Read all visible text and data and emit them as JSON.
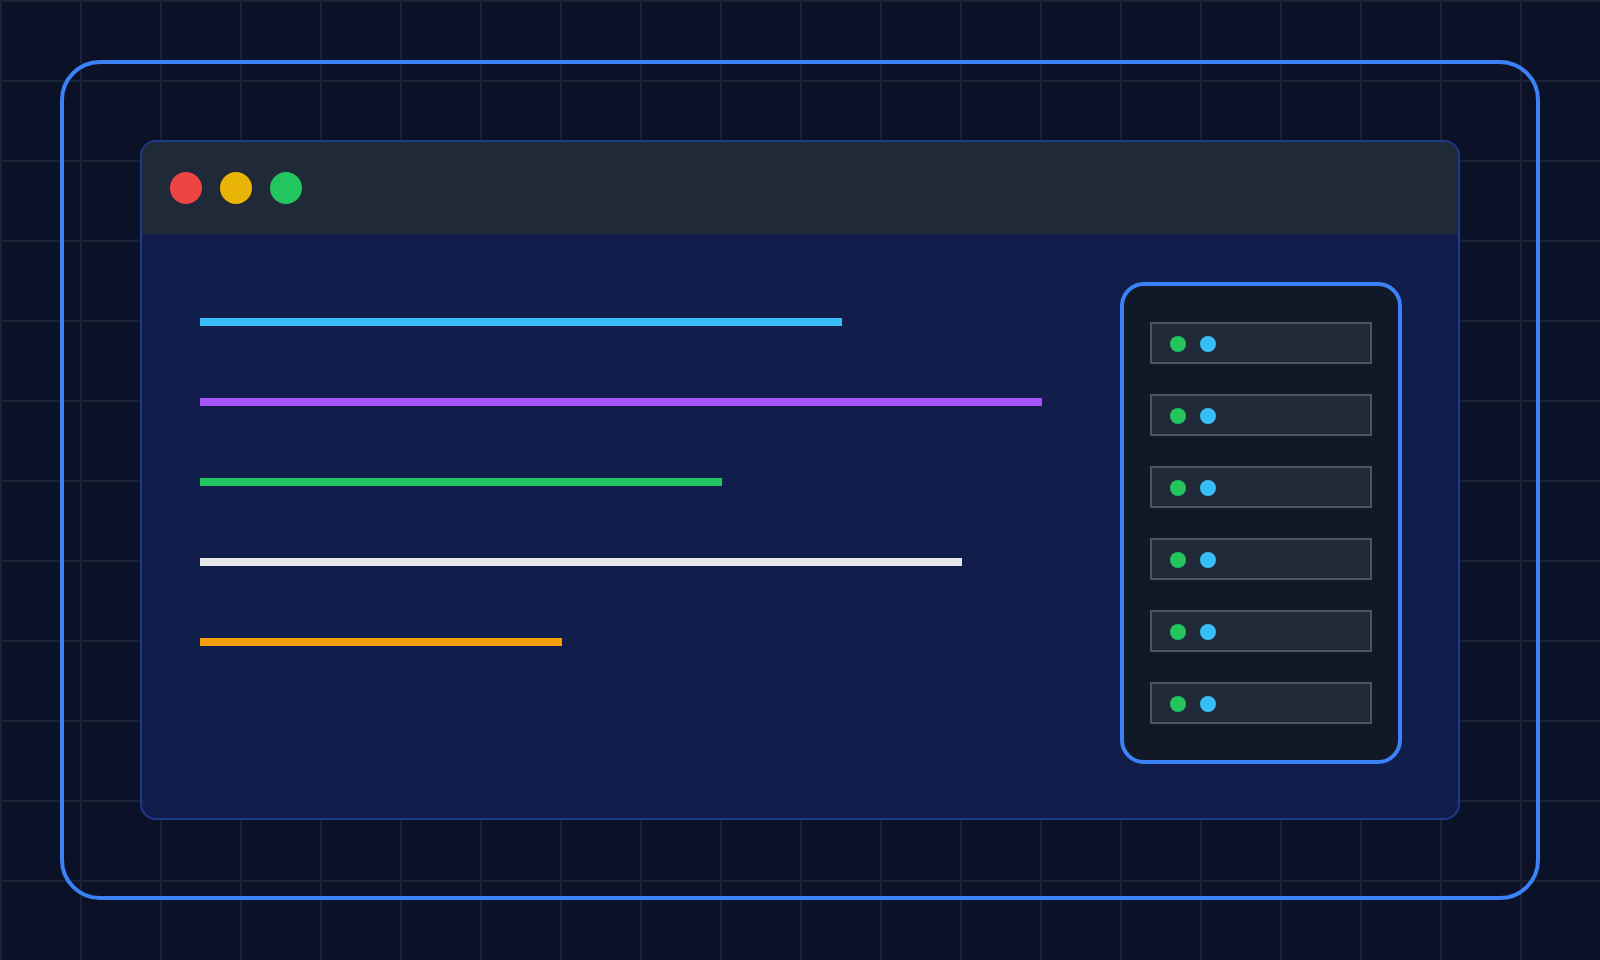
{
  "window": {
    "controls": [
      {
        "color": "#ef4444"
      },
      {
        "color": "#eab308"
      },
      {
        "color": "#22c55e"
      }
    ]
  },
  "code_lines": [
    {
      "color": "#38bdf8"
    },
    {
      "color": "#a855f7"
    },
    {
      "color": "#22c55e"
    },
    {
      "color": "#e5e7eb"
    },
    {
      "color": "#f59e0b"
    }
  ],
  "server_rack": {
    "slots": [
      {
        "lights": [
          {
            "color": "#22c55e"
          },
          {
            "color": "#38bdf8"
          }
        ]
      },
      {
        "lights": [
          {
            "color": "#22c55e"
          },
          {
            "color": "#38bdf8"
          }
        ]
      },
      {
        "lights": [
          {
            "color": "#22c55e"
          },
          {
            "color": "#38bdf8"
          }
        ]
      },
      {
        "lights": [
          {
            "color": "#22c55e"
          },
          {
            "color": "#38bdf8"
          }
        ]
      },
      {
        "lights": [
          {
            "color": "#22c55e"
          },
          {
            "color": "#38bdf8"
          }
        ]
      },
      {
        "lights": [
          {
            "color": "#22c55e"
          },
          {
            "color": "#38bdf8"
          }
        ]
      }
    ]
  }
}
